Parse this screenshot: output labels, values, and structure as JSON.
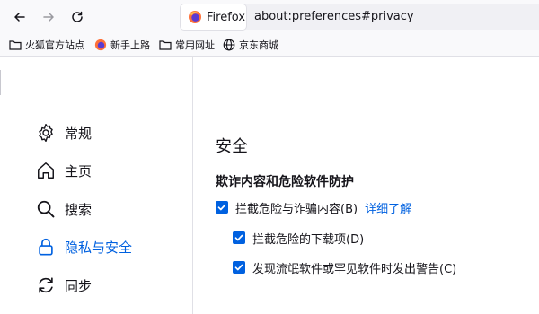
{
  "toolbar": {
    "back_icon": "arrow-left-icon",
    "forward_icon": "arrow-right-icon",
    "reload_icon": "reload-icon",
    "identity_label": "Firefox",
    "url": "about:preferences#privacy"
  },
  "bookmarks": [
    {
      "label": "火狐官方站点",
      "icon": "folder-icon"
    },
    {
      "label": "新手上路",
      "icon": "firefox-icon"
    },
    {
      "label": "常用网址",
      "icon": "folder-icon"
    },
    {
      "label": "京东商城",
      "icon": "globe-icon"
    }
  ],
  "sidebar": {
    "items": [
      {
        "label": "常规",
        "icon": "gear-icon"
      },
      {
        "label": "主页",
        "icon": "home-icon"
      },
      {
        "label": "搜索",
        "icon": "search-icon"
      },
      {
        "label": "隐私与安全",
        "icon": "lock-icon"
      },
      {
        "label": "同步",
        "icon": "sync-icon"
      }
    ]
  },
  "main": {
    "section_title": "安全",
    "subsection_title": "欺诈内容和危险软件防护",
    "options": [
      {
        "label": "拦截危险与诈骗内容(B)",
        "checked": true,
        "link": "详细了解"
      },
      {
        "label": "拦截危险的下载项(D)",
        "checked": true
      },
      {
        "label": "发现流氓软件或罕见软件时发出警告(C)",
        "checked": true
      }
    ]
  },
  "colors": {
    "accent": "#0061e0",
    "text": "#15141a",
    "toolbar_bg": "#f9f9fb"
  }
}
